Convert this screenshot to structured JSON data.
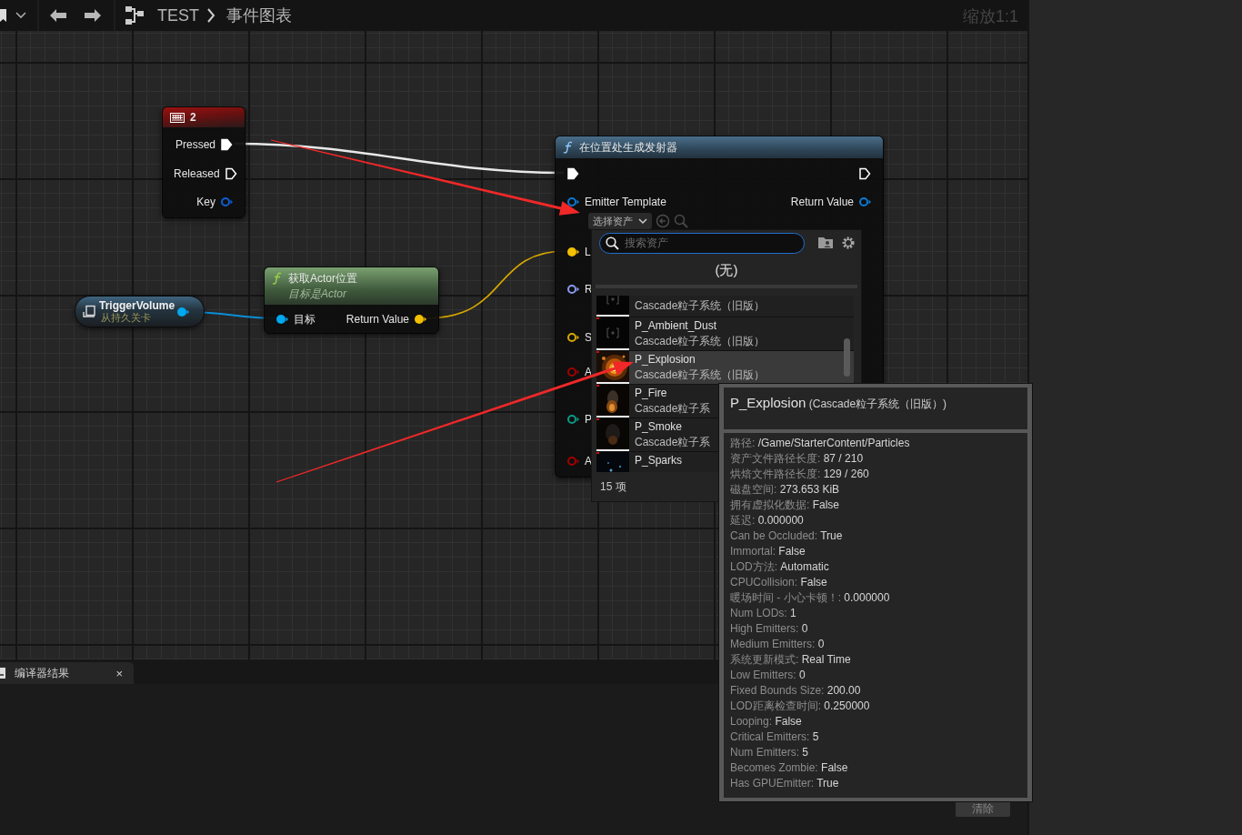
{
  "toolbar": {
    "breadcrumb": [
      "TEST",
      "事件图表"
    ],
    "zoom_label": "缩放1:1"
  },
  "graph": {
    "nodes": [
      {
        "kind": "event",
        "title": "2",
        "outputs": [
          {
            "kind": "exec",
            "label": "Pressed",
            "connected": true
          },
          {
            "kind": "exec",
            "label": "Released",
            "connected": false
          },
          {
            "kind": "data",
            "label": "Key",
            "connected": false,
            "color": "#0a5fd6"
          }
        ]
      },
      {
        "kind": "variable",
        "title": "TriggerVolume",
        "subtitle": "从持久关卡",
        "outputs": [
          {
            "kind": "data",
            "connected": true,
            "color": "#00a8f0"
          }
        ]
      },
      {
        "kind": "function",
        "pure": true,
        "title": "获取Actor位置",
        "subtitle": "目标是Actor",
        "inputs": [
          {
            "kind": "data",
            "label": "目标",
            "connected": true,
            "color": "#00a8f0"
          }
        ],
        "outputs": [
          {
            "kind": "data",
            "label": "Return Value",
            "connected": true,
            "color": "#f2c000"
          }
        ]
      },
      {
        "kind": "function",
        "pure": false,
        "title": "在位置处生成发射器",
        "asset_field": {
          "label": "选择资产"
        },
        "inputs": [
          {
            "kind": "exec",
            "connected": true
          },
          {
            "kind": "data",
            "label": "Emitter Template",
            "connected": false,
            "color": "#0a7ad6"
          },
          {
            "kind": "data",
            "label": "L",
            "connected": true,
            "color": "#f2c000"
          },
          {
            "kind": "data",
            "label": "R",
            "connected": false,
            "color": "#8a9bf0"
          },
          {
            "kind": "data",
            "label": "S",
            "connected": false,
            "color": "#d8a800"
          },
          {
            "kind": "data",
            "label": "A",
            "connected": false,
            "color": "#a00000"
          },
          {
            "kind": "data",
            "label": "P",
            "connected": false,
            "color": "#0a9a88"
          },
          {
            "kind": "data",
            "label": "A",
            "connected": false,
            "color": "#a00000"
          }
        ],
        "outputs": [
          {
            "kind": "exec",
            "connected": false
          },
          {
            "kind": "data",
            "label": "Return Value",
            "connected": false,
            "color": "#0a7ad6"
          }
        ]
      }
    ]
  },
  "asset_picker": {
    "search_placeholder": "搜索资产",
    "none_label": "(无)",
    "count": "15 项",
    "items": [
      {
        "type": "Cascade粒子系统（旧版）",
        "kind": "empty",
        "selected": false
      },
      {
        "name": "P_Ambient_Dust",
        "type": "Cascade粒子系统（旧版）",
        "kind": "empty",
        "selected": false
      },
      {
        "name": "P_Explosion",
        "type": "Cascade粒子系统（旧版）",
        "kind": "picture",
        "selected": true
      },
      {
        "name": "P_Fire",
        "type": "Cascade粒子系",
        "kind": "picture",
        "selected": false
      },
      {
        "name": "P_Smoke",
        "type": "Cascade粒子系",
        "kind": "picture",
        "selected": false
      },
      {
        "name": "P_Sparks",
        "kind": "picture",
        "selected": false
      }
    ]
  },
  "tooltip": {
    "name": "P_Explosion",
    "type": "(Cascade粒子系统（旧版）)",
    "properties": [
      {
        "key": "路径:",
        "value": "/Game/StarterContent/Particles"
      },
      {
        "key": "资产文件路径长度:",
        "value": "87 / 210"
      },
      {
        "key": "烘焙文件路径长度:",
        "value": "129 / 260"
      },
      {
        "key": "磁盘空间:",
        "value": "273.653 KiB"
      },
      {
        "key": "拥有虚拟化数据:",
        "value": "False"
      },
      {
        "key": "延迟:",
        "value": "0.000000"
      },
      {
        "key": "Can be Occluded:",
        "value": "True"
      },
      {
        "key": "Immortal:",
        "value": "False"
      },
      {
        "key": "LOD方法:",
        "value": "Automatic"
      },
      {
        "key": "CPUCollision:",
        "value": "False"
      },
      {
        "key": "暖场时间 - 小心卡顿！:",
        "value": "0.000000"
      },
      {
        "key": "Num LODs:",
        "value": "1"
      },
      {
        "key": "High Emitters:",
        "value": "0"
      },
      {
        "key": "Medium Emitters:",
        "value": "0"
      },
      {
        "key": "系统更新模式:",
        "value": "Real Time"
      },
      {
        "key": "Low Emitters:",
        "value": "0"
      },
      {
        "key": "Fixed Bounds Size:",
        "value": "200.00"
      },
      {
        "key": "LOD距离检查时间:",
        "value": "0.250000"
      },
      {
        "key": "Looping:",
        "value": "False"
      },
      {
        "key": "Critical Emitters:",
        "value": "5"
      },
      {
        "key": "Num Emitters:",
        "value": "5"
      },
      {
        "key": "Becomes Zombie:",
        "value": "False"
      },
      {
        "key": "Has GPUEmitter:",
        "value": "True"
      }
    ]
  },
  "bottom_panel": {
    "tab": "编译器结果",
    "close": "×",
    "clear_button": "清除"
  }
}
